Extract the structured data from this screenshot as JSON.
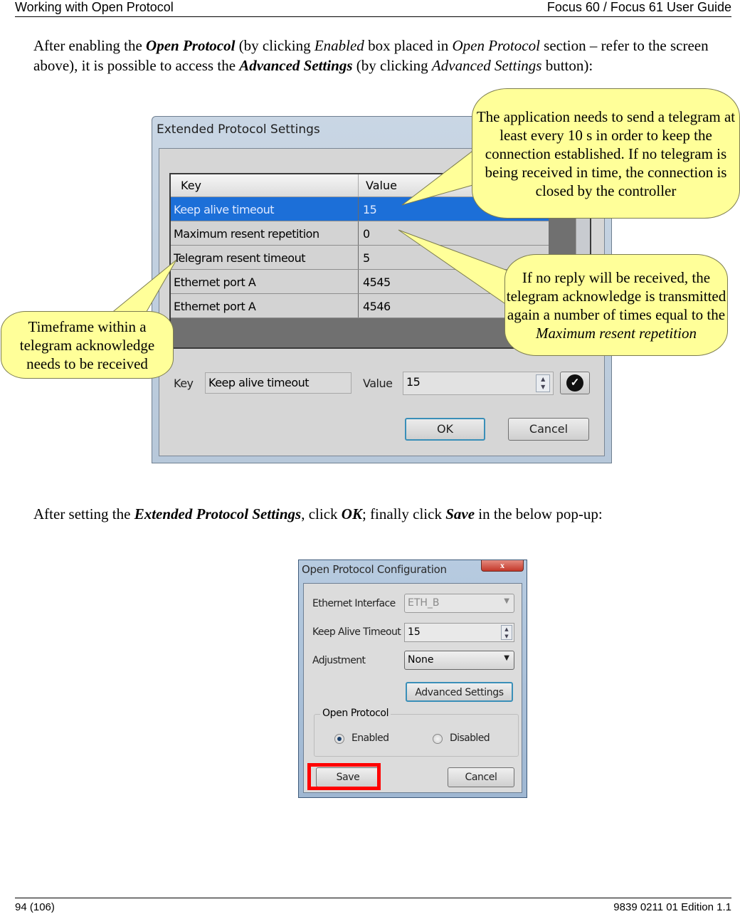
{
  "header": {
    "left": "Working with Open Protocol",
    "right": "Focus 60 / Focus 61 User Guide"
  },
  "paragraph1": {
    "t1": "After enabling the ",
    "b1": "Open Protocol",
    "t2": " (by clicking ",
    "i1": "Enabled",
    "t3": " box placed in ",
    "i2": "Open Protocol",
    "t4": " section – refer to the screen above), it is possible to access the ",
    "b2": "Advanced Settings",
    "t5": " (by clicking ",
    "i3": "Advanced Settings",
    "t6": " button):"
  },
  "extended_dialog": {
    "title": "Extended Protocol Settings",
    "columns": {
      "key": "Key",
      "value": "Value"
    },
    "rows": [
      {
        "key": "Keep alive timeout",
        "value": "15",
        "selected": true
      },
      {
        "key": "Maximum resent repetition",
        "value": "0"
      },
      {
        "key": "Telegram resent timeout",
        "value": "5"
      },
      {
        "key": "Ethernet port A",
        "value": "4545"
      },
      {
        "key": "Ethernet port A",
        "value": "4546"
      }
    ],
    "key_label": "Key",
    "key_field": "Keep alive timeout",
    "value_label": "Value",
    "value_field": "15",
    "apply_icon": "checkmark-icon",
    "ok_label": "OK",
    "cancel_label": "Cancel"
  },
  "callouts": {
    "keep_alive": "The application needs to send a telegram at least every 10 s in order to keep the connection established. If no telegram is being received in time, the connection is closed by the controller",
    "max_resent_pre": "If no reply will be received, the telegram acknowledge is transmitted again a number of times equal to the ",
    "max_resent_em": "Maximum resent repetition",
    "telegram_timeout": "Timeframe within a telegram acknowledge needs to be received"
  },
  "paragraph2": {
    "t1": "After setting the ",
    "b1": "Extended Protocol Settings",
    "t2": ", click ",
    "b2": "OK",
    "t3": "; finally click ",
    "b3": "Save",
    "t4": " in the below pop-up:"
  },
  "config_dialog": {
    "title": "Open Protocol Configuration",
    "close_label": "x",
    "ethernet_label": "Ethernet Interface",
    "ethernet_value": "ETH_B",
    "keepalive_label": "Keep Alive Timeout",
    "keepalive_value": "15",
    "adjustment_label": "Adjustment",
    "adjustment_value": "None",
    "advanced_label": "Advanced Settings",
    "group_label": "Open Protocol",
    "enabled_label": "Enabled",
    "disabled_label": "Disabled",
    "selected_mode": "Enabled",
    "save_label": "Save",
    "cancel_label": "Cancel",
    "highlight_color": "#ff0000"
  },
  "footer": {
    "left": "94 (106)",
    "right": "9839 0211 01 Edition 1.1"
  }
}
